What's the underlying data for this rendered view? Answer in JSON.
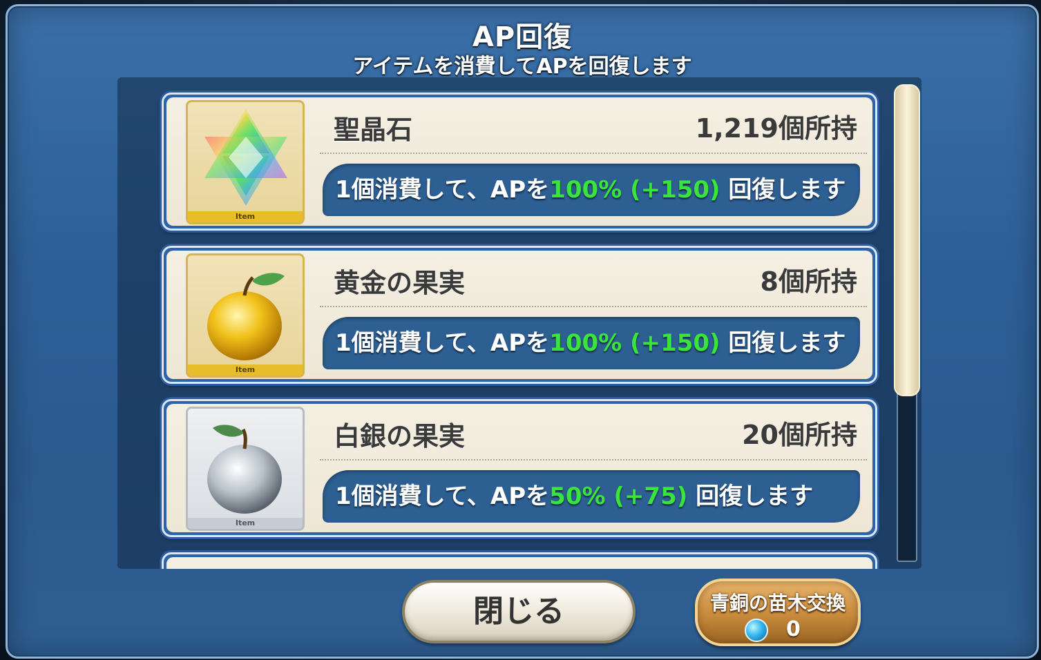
{
  "dialog": {
    "title": "AP回復",
    "subtitle": "アイテムを消費してAPを回復します"
  },
  "items": [
    {
      "name": "聖晶石",
      "count": "1,219個所持",
      "tag": "Item",
      "effect_prefix": "1個消費して、APを",
      "effect_value": "100% (+150)",
      "effect_suffix": " 回復します",
      "icon": "saint-quartz-icon"
    },
    {
      "name": "黄金の果実",
      "count": "8個所持",
      "tag": "Item",
      "effect_prefix": "1個消費して、APを",
      "effect_value": "100% (+150)",
      "effect_suffix": " 回復します",
      "icon": "golden-apple-icon"
    },
    {
      "name": "白銀の果実",
      "count": "20個所持",
      "tag": "Item",
      "effect_prefix": "1個消費して、APを",
      "effect_value": "50% (+75)",
      "effect_suffix": " 回復します",
      "icon": "silver-apple-icon"
    }
  ],
  "buttons": {
    "close_label": "閉じる",
    "exchange_label": "青銅の苗木交換",
    "exchange_count": "0"
  },
  "colors": {
    "accent_green": "#39e43c",
    "panel_blue": "#2e5f92",
    "card_bg": "#f4efe2"
  }
}
